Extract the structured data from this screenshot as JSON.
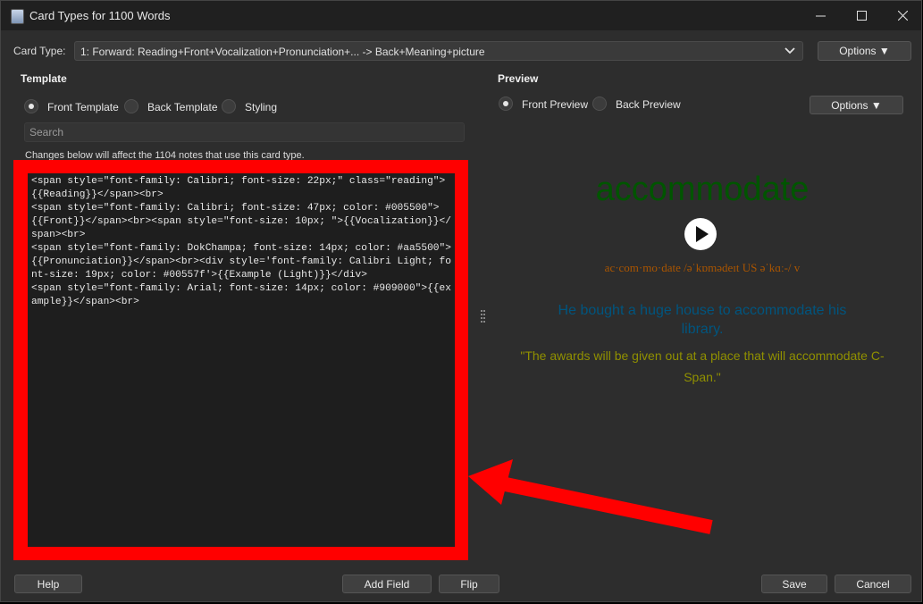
{
  "window": {
    "title": "Card Types for 1100 Words"
  },
  "card_type": {
    "label": "Card Type:",
    "value": "1: Forward: Reading+Front+Vocalization+Pronunciation+... -> Back+Meaning+picture",
    "options_label": "Options ▼"
  },
  "template": {
    "title": "Template",
    "radios": [
      "Front Template",
      "Back Template",
      "Styling"
    ],
    "selected": "Front Template",
    "search_placeholder": "Search",
    "changes_notice": "Changes below will affect the 1104 notes that use this card type.",
    "code": "<span style=\"font-family: Calibri; font-size: 22px;\" class=\"reading\">{{Reading}}</span><br>\n<span style=\"font-family: Calibri; font-size: 47px; color: #005500\">{{Front}}</span><br><span style=\"font-size: 10px; \">{{Vocalization}}</span><br>\n<span style=\"font-family: DokChampa; font-size: 14px; color: #aa5500\">{{Pronunciation}}</span><br><div style='font-family: Calibri Light; font-size: 19px; color: #00557f'>{{Example (Light)}}</div>\n<span style=\"font-family: Arial; font-size: 14px; color: #909000\">{{example}}</span><br>"
  },
  "preview": {
    "title": "Preview",
    "radios": [
      "Front Preview",
      "Back Preview"
    ],
    "selected": "Front Preview",
    "options_label": "Options ▼",
    "word": "accommodate",
    "pronunciation": "ac·com·mo·date /əˈkɒmədeɪt US əˈkɑː-/ v",
    "example": "He bought a huge house to accommodate his library.",
    "quote": "\"The awards will be given out at a place that will accommodate C-Span.\""
  },
  "buttons": {
    "help": "Help",
    "add_field": "Add Field",
    "flip": "Flip",
    "save": "Save",
    "cancel": "Cancel"
  },
  "colors": {
    "annotation_red": "#ff0000",
    "front_color": "#005500",
    "pronunciation_color": "#aa5500",
    "example_color": "#00557f",
    "quote_color": "#909000"
  }
}
